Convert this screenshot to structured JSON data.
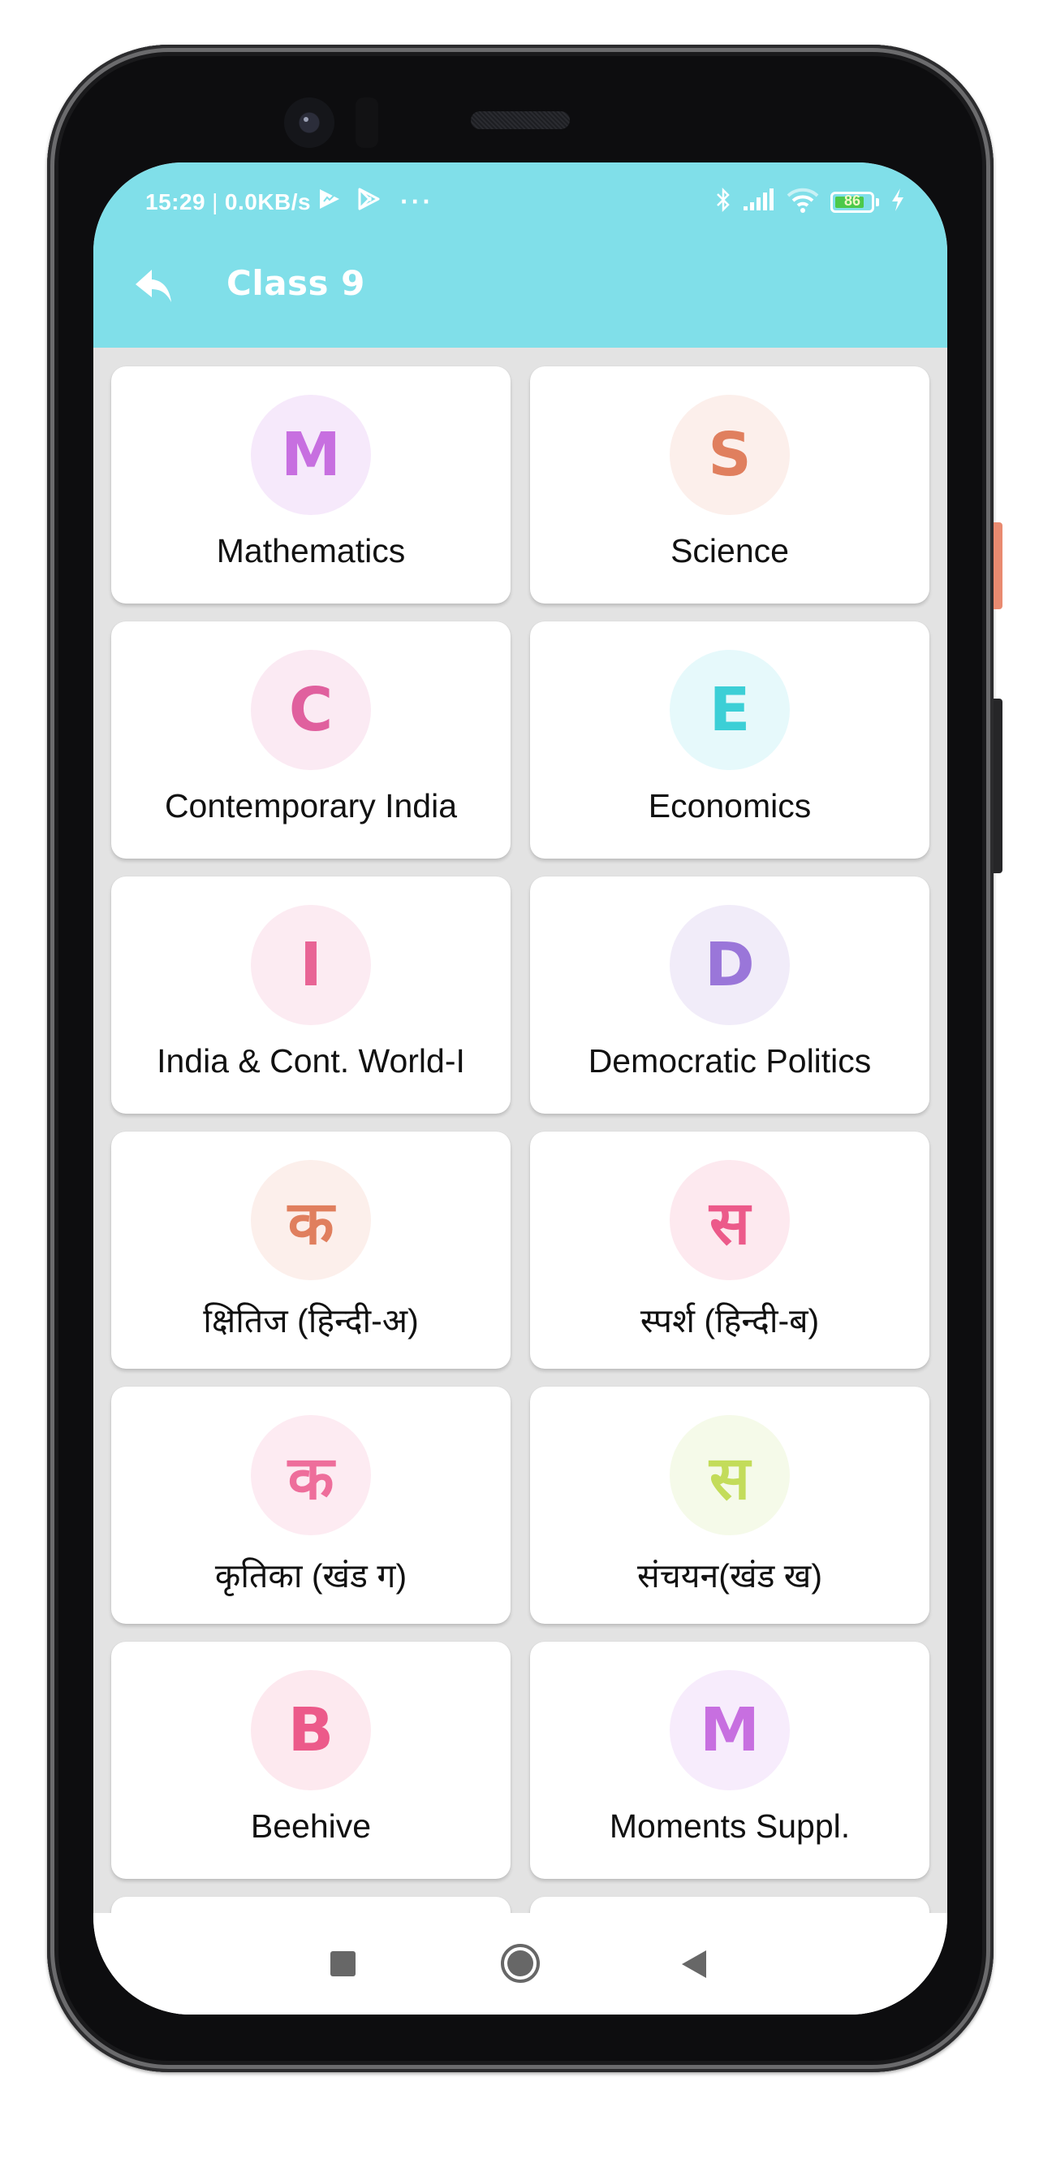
{
  "status_bar": {
    "time": "15:29",
    "separator": "|",
    "network_speed": "0.0KB/s",
    "overflow": "···",
    "battery_level": 86,
    "battery_label": "86",
    "icons_left": [
      "play-store-alt-icon",
      "play-store-icon",
      "more-notifications-icon"
    ],
    "icons_right": [
      "bluetooth-icon",
      "signal-icon",
      "wifi-icon",
      "battery-icon",
      "charging-icon"
    ]
  },
  "toolbar": {
    "back_icon": "reply-arrow-icon",
    "title": "Class 9",
    "background": "#80dfe9"
  },
  "subjects": [
    {
      "letter": "M",
      "label": "Mathematics",
      "color": "#c76fe0",
      "bg": "#f6e9fb"
    },
    {
      "letter": "S",
      "label": "Science",
      "color": "#e07f5e",
      "bg": "#fcefeb"
    },
    {
      "letter": "C",
      "label": "Contemporary India",
      "color": "#e0609e",
      "bg": "#fbeaf3"
    },
    {
      "letter": "E",
      "label": "Economics",
      "color": "#3ccfd6",
      "bg": "#e6f9fb"
    },
    {
      "letter": "I",
      "label": "India & Cont. World-I",
      "color": "#e86495",
      "bg": "#fcebf2"
    },
    {
      "letter": "D",
      "label": "Democratic Politics",
      "color": "#9a76d9",
      "bg": "#f1ecf9"
    },
    {
      "letter": "क",
      "label": "क्षितिज (हिन्दी-अ)",
      "color": "#e07f5e",
      "bg": "#fcefeb"
    },
    {
      "letter": "स",
      "label": "स्पर्श (हिन्दी-ब)",
      "color": "#ec5a8a",
      "bg": "#fde9ef"
    },
    {
      "letter": "क",
      "label": "कृतिका (खंड ग)",
      "color": "#ee6e9b",
      "bg": "#fdebf2"
    },
    {
      "letter": "स",
      "label": "संचयन(खंड ख)",
      "color": "#c3dc5a",
      "bg": "#f5fae9"
    },
    {
      "letter": "B",
      "label": "Beehive",
      "color": "#ec5a8a",
      "bg": "#fde9ef"
    },
    {
      "letter": "M",
      "label": "Moments Suppl.",
      "color": "#c76fe0",
      "bg": "#f7ecfc"
    },
    {
      "letter": "",
      "label": "",
      "color": "#000000",
      "bg": "#ffffff"
    },
    {
      "letter": "",
      "label": "",
      "color": "#000000",
      "bg": "#ffffff"
    }
  ],
  "nav_bar": {
    "recents_icon": "square-recents-icon",
    "home_icon": "circle-home-icon",
    "back_icon": "triangle-back-icon"
  },
  "device": {
    "power_button_color": "#e98a70"
  }
}
